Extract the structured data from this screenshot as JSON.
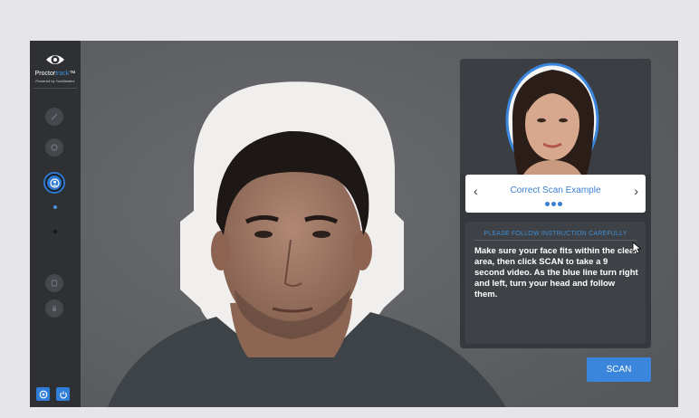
{
  "brand": {
    "name_part1": "Proctor",
    "name_part2": "track",
    "tm": "™",
    "tagline": "Powered by YouMasters"
  },
  "sidebar": {
    "steps": [
      {
        "icon": "edit-icon",
        "state": "inactive"
      },
      {
        "icon": "settings-icon",
        "state": "inactive"
      },
      {
        "icon": "face-scan-icon",
        "state": "active"
      },
      {
        "icon": "document-icon",
        "state": "inactive"
      },
      {
        "icon": "lock-icon",
        "state": "inactive"
      }
    ],
    "bottom_buttons": [
      "help-icon",
      "power-icon"
    ]
  },
  "example": {
    "title": "Correct Scan Example",
    "prev_label": "‹",
    "next_label": "›",
    "dots": 3
  },
  "instructions": {
    "heading": "PLEASE FOLLOW INSTRUCTION CAREFULLY",
    "body": "Make sure your face fits within the clear area, then click SCAN to take a 9 second video. As the blue line turn right and left, turn your head and follow them."
  },
  "scan_button": {
    "label": "SCAN"
  },
  "colors": {
    "accent": "#3a86dd",
    "sidebar": "#2e3033",
    "panel": "#35383c",
    "camera_bg": "#5f6165"
  }
}
